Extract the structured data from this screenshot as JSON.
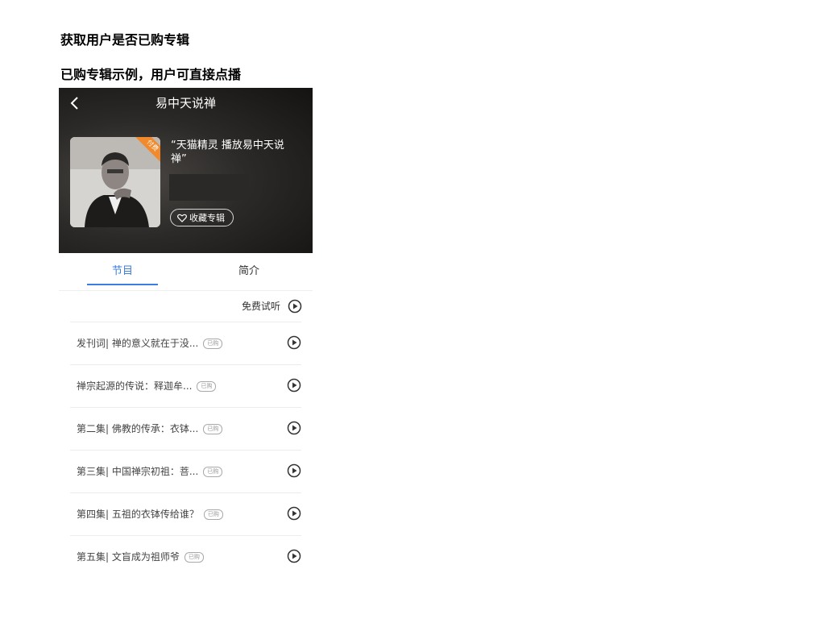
{
  "headings": {
    "h1": "获取用户是否已购专辑",
    "h2": "已购专辑示例，用户可直接点播"
  },
  "nav": {
    "back_icon": "chevron-left-icon",
    "title": "易中天说禅"
  },
  "album": {
    "badge": "付费",
    "name": "“天猫精灵 播放易中天说禅”",
    "favorite_label": "收藏专辑",
    "favorite_icon": "heart-outline-icon"
  },
  "tabs": [
    {
      "label": "节目",
      "active": true
    },
    {
      "label": "简介",
      "active": false
    }
  ],
  "trial": {
    "label": "免费试听",
    "icon": "play-circle-icon"
  },
  "episodes": [
    {
      "title": "发刊词| 禅的意义就在于没...",
      "tag": "已购"
    },
    {
      "title": "禅宗起源的传说：释迦牟...",
      "tag": "已购"
    },
    {
      "title": "第二集| 佛教的传承：衣钵...",
      "tag": "已购"
    },
    {
      "title": "第三集| 中国禅宗初祖：菩...",
      "tag": "已购"
    },
    {
      "title": "第四集| 五祖的衣钵传给谁？",
      "tag": "已购"
    },
    {
      "title": "第五集| 文盲成为祖师爷",
      "tag": "已购"
    }
  ],
  "colors": {
    "accent": "#3b7de0",
    "badge": "#f08a2c",
    "hero_dark": "#141312"
  }
}
